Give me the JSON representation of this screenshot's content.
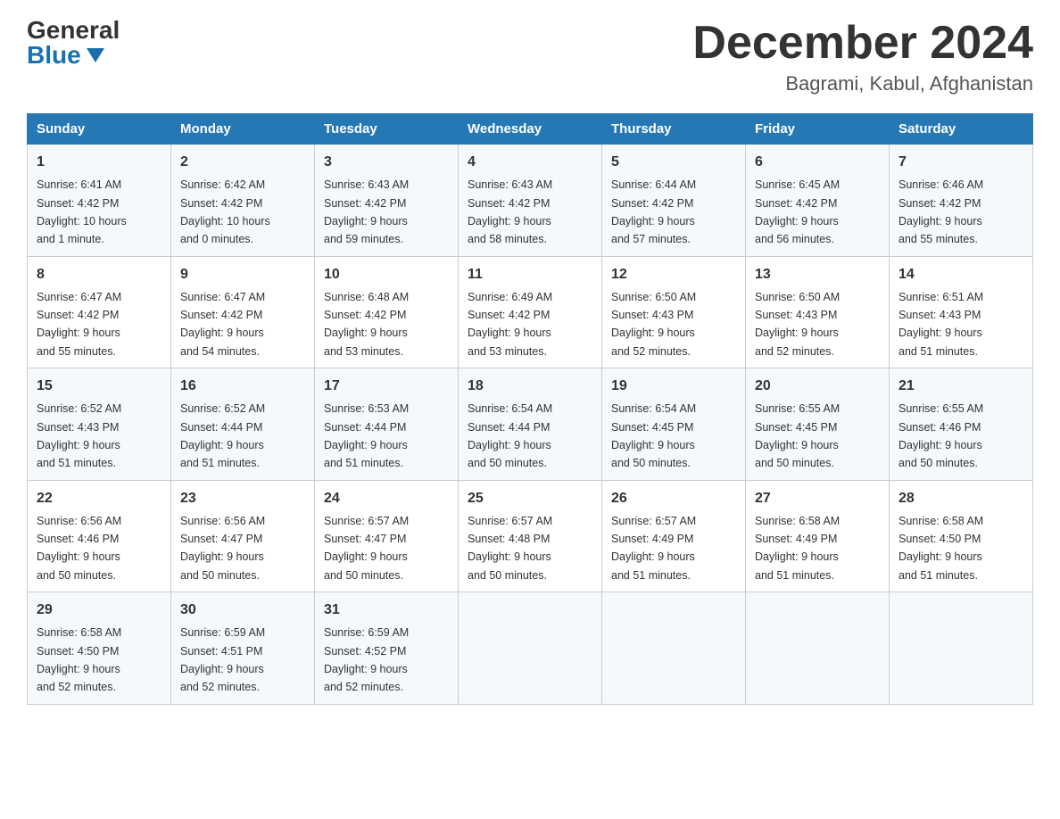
{
  "header": {
    "logo_general": "General",
    "logo_blue": "Blue",
    "month_title": "December 2024",
    "location": "Bagrami, Kabul, Afghanistan"
  },
  "days_of_week": [
    "Sunday",
    "Monday",
    "Tuesday",
    "Wednesday",
    "Thursday",
    "Friday",
    "Saturday"
  ],
  "weeks": [
    [
      {
        "day": "1",
        "sunrise": "6:41 AM",
        "sunset": "4:42 PM",
        "daylight": "10 hours and 1 minute."
      },
      {
        "day": "2",
        "sunrise": "6:42 AM",
        "sunset": "4:42 PM",
        "daylight": "10 hours and 0 minutes."
      },
      {
        "day": "3",
        "sunrise": "6:43 AM",
        "sunset": "4:42 PM",
        "daylight": "9 hours and 59 minutes."
      },
      {
        "day": "4",
        "sunrise": "6:43 AM",
        "sunset": "4:42 PM",
        "daylight": "9 hours and 58 minutes."
      },
      {
        "day": "5",
        "sunrise": "6:44 AM",
        "sunset": "4:42 PM",
        "daylight": "9 hours and 57 minutes."
      },
      {
        "day": "6",
        "sunrise": "6:45 AM",
        "sunset": "4:42 PM",
        "daylight": "9 hours and 56 minutes."
      },
      {
        "day": "7",
        "sunrise": "6:46 AM",
        "sunset": "4:42 PM",
        "daylight": "9 hours and 55 minutes."
      }
    ],
    [
      {
        "day": "8",
        "sunrise": "6:47 AM",
        "sunset": "4:42 PM",
        "daylight": "9 hours and 55 minutes."
      },
      {
        "day": "9",
        "sunrise": "6:47 AM",
        "sunset": "4:42 PM",
        "daylight": "9 hours and 54 minutes."
      },
      {
        "day": "10",
        "sunrise": "6:48 AM",
        "sunset": "4:42 PM",
        "daylight": "9 hours and 53 minutes."
      },
      {
        "day": "11",
        "sunrise": "6:49 AM",
        "sunset": "4:42 PM",
        "daylight": "9 hours and 53 minutes."
      },
      {
        "day": "12",
        "sunrise": "6:50 AM",
        "sunset": "4:43 PM",
        "daylight": "9 hours and 52 minutes."
      },
      {
        "day": "13",
        "sunrise": "6:50 AM",
        "sunset": "4:43 PM",
        "daylight": "9 hours and 52 minutes."
      },
      {
        "day": "14",
        "sunrise": "6:51 AM",
        "sunset": "4:43 PM",
        "daylight": "9 hours and 51 minutes."
      }
    ],
    [
      {
        "day": "15",
        "sunrise": "6:52 AM",
        "sunset": "4:43 PM",
        "daylight": "9 hours and 51 minutes."
      },
      {
        "day": "16",
        "sunrise": "6:52 AM",
        "sunset": "4:44 PM",
        "daylight": "9 hours and 51 minutes."
      },
      {
        "day": "17",
        "sunrise": "6:53 AM",
        "sunset": "4:44 PM",
        "daylight": "9 hours and 51 minutes."
      },
      {
        "day": "18",
        "sunrise": "6:54 AM",
        "sunset": "4:44 PM",
        "daylight": "9 hours and 50 minutes."
      },
      {
        "day": "19",
        "sunrise": "6:54 AM",
        "sunset": "4:45 PM",
        "daylight": "9 hours and 50 minutes."
      },
      {
        "day": "20",
        "sunrise": "6:55 AM",
        "sunset": "4:45 PM",
        "daylight": "9 hours and 50 minutes."
      },
      {
        "day": "21",
        "sunrise": "6:55 AM",
        "sunset": "4:46 PM",
        "daylight": "9 hours and 50 minutes."
      }
    ],
    [
      {
        "day": "22",
        "sunrise": "6:56 AM",
        "sunset": "4:46 PM",
        "daylight": "9 hours and 50 minutes."
      },
      {
        "day": "23",
        "sunrise": "6:56 AM",
        "sunset": "4:47 PM",
        "daylight": "9 hours and 50 minutes."
      },
      {
        "day": "24",
        "sunrise": "6:57 AM",
        "sunset": "4:47 PM",
        "daylight": "9 hours and 50 minutes."
      },
      {
        "day": "25",
        "sunrise": "6:57 AM",
        "sunset": "4:48 PM",
        "daylight": "9 hours and 50 minutes."
      },
      {
        "day": "26",
        "sunrise": "6:57 AM",
        "sunset": "4:49 PM",
        "daylight": "9 hours and 51 minutes."
      },
      {
        "day": "27",
        "sunrise": "6:58 AM",
        "sunset": "4:49 PM",
        "daylight": "9 hours and 51 minutes."
      },
      {
        "day": "28",
        "sunrise": "6:58 AM",
        "sunset": "4:50 PM",
        "daylight": "9 hours and 51 minutes."
      }
    ],
    [
      {
        "day": "29",
        "sunrise": "6:58 AM",
        "sunset": "4:50 PM",
        "daylight": "9 hours and 52 minutes."
      },
      {
        "day": "30",
        "sunrise": "6:59 AM",
        "sunset": "4:51 PM",
        "daylight": "9 hours and 52 minutes."
      },
      {
        "day": "31",
        "sunrise": "6:59 AM",
        "sunset": "4:52 PM",
        "daylight": "9 hours and 52 minutes."
      },
      null,
      null,
      null,
      null
    ]
  ],
  "labels": {
    "sunrise": "Sunrise:",
    "sunset": "Sunset:",
    "daylight": "Daylight:"
  }
}
